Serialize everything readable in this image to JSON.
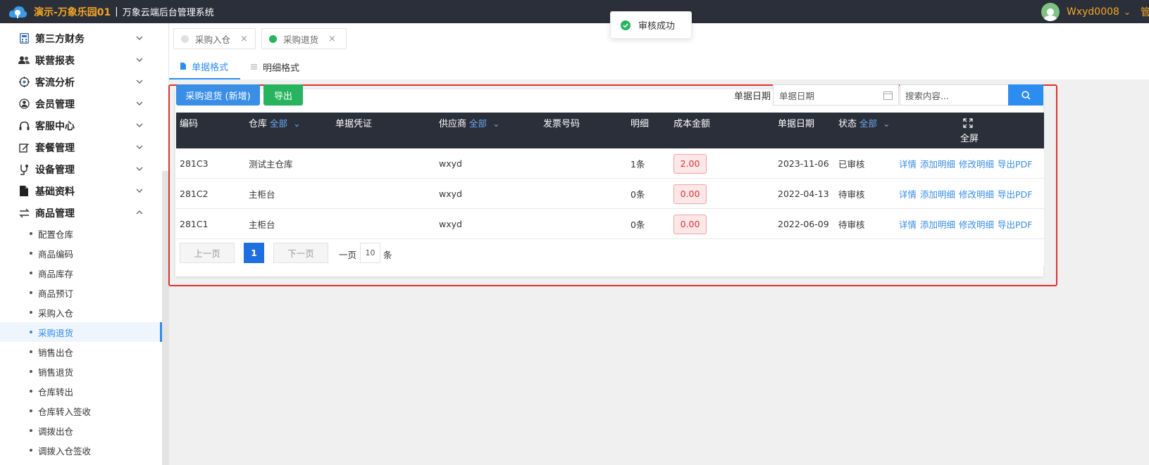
{
  "topbar": {
    "brand": "演示-万象乐园01",
    "separator": "|",
    "system_name": "万象云端后台管理系统",
    "username": "Wxyd0008",
    "extra": "管"
  },
  "toast": {
    "message": "审核成功"
  },
  "sidebar": {
    "groups": [
      {
        "label": "第三方财务",
        "icon": "calculator-icon"
      },
      {
        "label": "联营报表",
        "icon": "users-icon"
      },
      {
        "label": "客流分析",
        "icon": "target-icon"
      },
      {
        "label": "会员管理",
        "icon": "member-icon"
      },
      {
        "label": "客服中心",
        "icon": "headset-icon"
      },
      {
        "label": "套餐管理",
        "icon": "edit-icon"
      },
      {
        "label": "设备管理",
        "icon": "device-icon"
      },
      {
        "label": "基础资料",
        "icon": "file-icon"
      },
      {
        "label": "商品管理",
        "icon": "exchange-icon"
      }
    ],
    "sub_items": [
      "配置仓库",
      "商品编码",
      "商品库存",
      "商品预订",
      "采购入仓",
      "采购退货",
      "销售出仓",
      "销售退货",
      "仓库转出",
      "仓库转入签收",
      "调拨出仓",
      "调拨入仓签收"
    ],
    "active_sub": "采购退货"
  },
  "page_tabs": [
    {
      "label": "采购入仓",
      "close": "×",
      "active": false
    },
    {
      "label": "采购退货",
      "close": "×",
      "active": true
    }
  ],
  "sub_tabs": [
    {
      "label": "单据格式",
      "active": true
    },
    {
      "label": "明细格式",
      "active": false
    }
  ],
  "toolbar": {
    "new_label": "采购退货 (新增)",
    "export_label": "导出",
    "date_label": "单据日期",
    "date_placeholder": "单据日期",
    "search_placeholder": "搜索内容..."
  },
  "table": {
    "headers": {
      "code": "编码",
      "warehouse": "仓库",
      "warehouse_filter": "全部",
      "voucher": "单据凭证",
      "supplier": "供应商",
      "supplier_filter": "全部",
      "invoice": "发票号码",
      "detail": "明细",
      "cost": "成本金额",
      "date": "单据日期",
      "status": "状态",
      "status_filter": "全部",
      "fullscreen": "全屏"
    },
    "rows": [
      {
        "code": "281C3",
        "warehouse": "测试主仓库",
        "voucher": "",
        "supplier": "wxyd",
        "invoice": "",
        "detail": "1条",
        "cost": "2.00",
        "date": "2023-11-06",
        "status": "已审核"
      },
      {
        "code": "281C2",
        "warehouse": "主柜台",
        "voucher": "",
        "supplier": "wxyd",
        "invoice": "",
        "detail": "0条",
        "cost": "0.00",
        "date": "2022-04-13",
        "status": "待审核"
      },
      {
        "code": "281C1",
        "warehouse": "主柜台",
        "voucher": "",
        "supplier": "wxyd",
        "invoice": "",
        "detail": "0条",
        "cost": "0.00",
        "date": "2022-06-09",
        "status": "待审核"
      }
    ],
    "actions": [
      "详情",
      "添加明细",
      "修改明细",
      "导出PDF"
    ]
  },
  "pager": {
    "prev": "上一页",
    "current": "1",
    "next": "下一页",
    "per_page_label": "一页",
    "per_page": "10",
    "unit": "条"
  },
  "colors": {
    "accent": "#2d8cf0",
    "header_bg": "#2b2f3a",
    "brand": "#f5a623",
    "frame": "#e0302f",
    "success": "#28b45e"
  }
}
